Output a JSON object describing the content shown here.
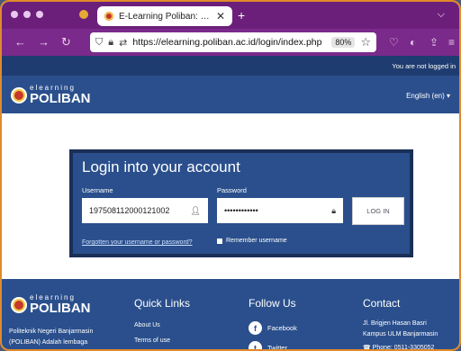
{
  "browser": {
    "tab_title": "E-Learning Poliban: Log in to th",
    "tab_close": "✕",
    "new_tab": "+",
    "url": "https://elearning.poliban.ac.id/login/index.php",
    "zoom": "80%"
  },
  "site": {
    "not_logged_in": "You are not logged in",
    "logo_top": "elearning",
    "logo_bottom": "POLIBAN",
    "language": "English (en) ▾"
  },
  "login": {
    "heading": "Login into your account",
    "username_label": "Username",
    "username_value": "197508112000121002",
    "password_label": "Password",
    "password_value": "••••••••••••",
    "button": "LOG IN",
    "forgot_link": "Forgotten your username or password?",
    "remember_label": "Remember username"
  },
  "footer": {
    "logo_top": "elearning",
    "logo_bottom": "POLIBAN",
    "about_line1": "Politeknik Negeri Banjarmasin",
    "about_line2": "(POLIBAN) Adalah lembaga",
    "quick_links_title": "Quick Links",
    "quick_links": [
      "About Us",
      "Terms of use"
    ],
    "follow_title": "Follow Us",
    "social": [
      "Facebook",
      "Twitter"
    ],
    "contact_title": "Contact",
    "contact_line1": "Jl. Brigjen Hasan Basri",
    "contact_line2": "Kampus ULM Banjarmasin",
    "contact_phone": "Phone: 0511-3305052"
  },
  "colors": {
    "browser_chrome": "#7a2a8a",
    "site_primary": "#2a4f8c",
    "site_dark": "#1e3c70",
    "frame_border": "#e08a2c"
  }
}
